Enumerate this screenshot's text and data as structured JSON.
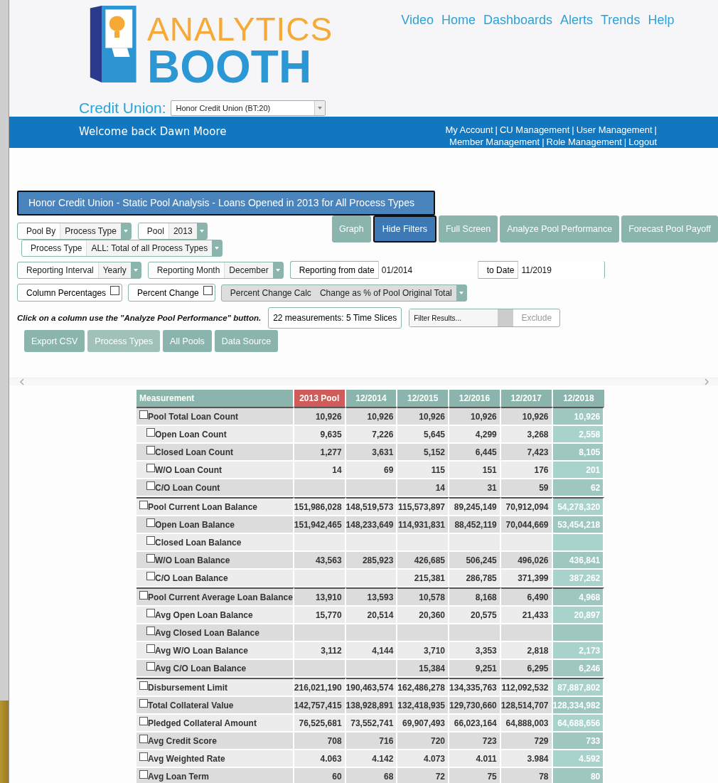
{
  "header": {
    "logo": {
      "line_1": "ANALYTICS",
      "line_2": "BOOTH"
    },
    "nav": [
      "Video",
      "Home",
      "Dashboards",
      "Alerts",
      "Trends",
      "Help"
    ],
    "credit_union": {
      "label": "Credit Union:",
      "value": "Honor Credit Union (BT:20)"
    }
  },
  "welcome_bar": {
    "greeting": "Welcome back Dawn Moore",
    "links_line_1": [
      "My Account",
      "CU Management",
      "User Management"
    ],
    "links_line_2": [
      "Member Management",
      "Role Management",
      "Logout"
    ],
    "separator": "|"
  },
  "report_title": "Honor Credit Union - Static Pool Analysis - Loans Opened in 2013 for All Process Types",
  "filters": {
    "row_1": [
      {
        "label": "Pool By",
        "value": "Process Type"
      },
      {
        "label": "Pool",
        "value": "2013"
      }
    ],
    "row_2": [
      {
        "label": "Process Type",
        "value": "ALL: Total of all Process Types"
      }
    ],
    "row_3": [
      {
        "label": "Reporting Interval",
        "value": "Yearly"
      },
      {
        "label": "Reporting Month",
        "value": "December"
      }
    ],
    "date_range": {
      "from_label": "Reporting from date",
      "from": "01/2014",
      "to_label": "to Date",
      "to": "11/2019"
    },
    "checkboxes": [
      {
        "label": "Column Percentages",
        "checked": false
      },
      {
        "label": "Percent Change",
        "checked": false
      }
    ],
    "percent_change_calc": {
      "label": "Percent Change Calc",
      "value": "Change as % of Pool Original Total"
    },
    "hint": "Click on a column use the \"Analyze Pool Performance\" button.",
    "measurements": "22 measurements: 5 Time Slices",
    "filter_results": {
      "placeholder": "Filter Results...",
      "toggle_label": "Exclude",
      "on": false
    }
  },
  "view_buttons": [
    {
      "label": "Graph",
      "selected": false
    },
    {
      "label": "Hide Filters",
      "selected": true
    },
    {
      "label": "Full Screen",
      "selected": false
    },
    {
      "label": "Analyze Pool Performance",
      "selected": false
    },
    {
      "label": "Forecast Pool Payoff",
      "selected": false
    }
  ],
  "action_buttons": [
    {
      "label": "Export CSV",
      "disabled": false
    },
    {
      "label": "Process Types",
      "disabled": true
    },
    {
      "label": "All Pools",
      "disabled": false
    },
    {
      "label": "Data Source",
      "disabled": false
    }
  ],
  "table": {
    "columns": [
      {
        "label": "Measurement",
        "kind": "measure",
        "selected": false
      },
      {
        "label": "2013 Pool",
        "kind": "pool",
        "selected": false
      },
      {
        "label": "12/2014",
        "kind": "period",
        "selected": false
      },
      {
        "label": "12/2015",
        "kind": "period",
        "selected": false
      },
      {
        "label": "12/2016",
        "kind": "period",
        "selected": false
      },
      {
        "label": "12/2017",
        "kind": "period",
        "selected": false
      },
      {
        "label": "12/2018",
        "kind": "period",
        "selected": true
      }
    ],
    "rows": [
      {
        "label": "Pool Total Loan Count",
        "checked": false,
        "values": [
          "10,926",
          "10,926",
          "10,926",
          "10,926",
          "10,926",
          "10,926"
        ],
        "children": [
          {
            "label": "Open Loan Count",
            "checked": false,
            "values": [
              "9,635",
              "7,226",
              "5,645",
              "4,299",
              "3,268",
              "2,558"
            ]
          },
          {
            "label": "Closed Loan Count",
            "checked": false,
            "values": [
              "1,277",
              "3,631",
              "5,152",
              "6,445",
              "7,423",
              "8,105"
            ]
          },
          {
            "label": "W/O Loan Count",
            "checked": false,
            "values": [
              "14",
              "69",
              "115",
              "151",
              "176",
              "201"
            ]
          },
          {
            "label": "C/O Loan Count",
            "checked": false,
            "values": [
              {
                "empty": true
              },
              {
                "empty": true
              },
              "14",
              "31",
              "59",
              "62"
            ]
          }
        ]
      },
      {
        "label": "Pool Current Loan Balance",
        "checked": false,
        "values": [
          "151,986,028",
          "148,519,573",
          "115,573,897",
          "89,245,149",
          "70,912,094",
          "54,278,320"
        ],
        "children": [
          {
            "label": "Open Loan Balance",
            "checked": false,
            "values": [
              "151,942,465",
              "148,233,649",
              "114,931,831",
              "88,452,119",
              "70,044,669",
              "53,454,218"
            ]
          },
          {
            "label": "Closed Loan Balance",
            "checked": false,
            "values": [
              {
                "empty": true
              },
              {
                "empty": true
              },
              {
                "empty": true
              },
              {
                "empty": true
              },
              {
                "empty": true
              },
              {
                "empty": true
              }
            ]
          },
          {
            "label": "W/O Loan Balance",
            "checked": false,
            "values": [
              "43,563",
              "285,923",
              "426,685",
              "506,245",
              "496,026",
              "436,841"
            ]
          },
          {
            "label": "C/O Loan Balance",
            "checked": false,
            "values": [
              {
                "empty": true
              },
              {
                "empty": true
              },
              "215,381",
              "286,785",
              "371,399",
              "387,262"
            ]
          }
        ]
      },
      {
        "label": "Pool Current Average Loan Balance",
        "checked": false,
        "values": [
          "13,910",
          "13,593",
          "10,578",
          "8,168",
          "6,490",
          "4,968"
        ],
        "children": [
          {
            "label": "Avg Open Loan Balance",
            "checked": false,
            "values": [
              "15,770",
              "20,514",
              "20,360",
              "20,575",
              "21,433",
              "20,897"
            ]
          },
          {
            "label": "Avg Closed Loan Balance",
            "checked": false,
            "values": [
              {
                "empty": true
              },
              {
                "empty": true
              },
              {
                "empty": true
              },
              {
                "empty": true
              },
              {
                "empty": true
              },
              {
                "empty": true
              }
            ]
          },
          {
            "label": "Avg W/O Loan Balance",
            "checked": false,
            "values": [
              "3,112",
              "4,144",
              "3,710",
              "3,353",
              "2,818",
              "2,173"
            ]
          },
          {
            "label": "Avg C/O Loan Balance",
            "checked": false,
            "values": [
              {
                "empty": true
              },
              {
                "empty": true
              },
              "15,384",
              "9,251",
              "6,295",
              "6,246"
            ]
          }
        ]
      },
      {
        "label": "Disbursement Limit",
        "checked": false,
        "values": [
          "216,021,190",
          "190,463,574",
          "162,486,278",
          "134,335,763",
          "112,092,532",
          "87,887,802"
        ]
      },
      {
        "label": "Total Collateral Value",
        "checked": false,
        "values": [
          "142,757,415",
          "138,928,891",
          "132,418,935",
          "129,730,660",
          "128,514,707",
          "128,334,982"
        ]
      },
      {
        "label": "Pledged Collateral Amount",
        "checked": false,
        "values": [
          "76,525,681",
          "73,552,741",
          "69,907,493",
          "66,023,164",
          "64,888,003",
          "64,688,656"
        ]
      },
      {
        "label": "Avg Credit Score",
        "checked": false,
        "values": [
          "708",
          "716",
          "720",
          "723",
          "729",
          "733"
        ]
      },
      {
        "label": "Avg Weighted Rate",
        "checked": false,
        "values": [
          "4.063",
          "4.142",
          "4.073",
          "4.011",
          "3.984",
          "4.592"
        ]
      },
      {
        "label": "Avg Loan Term",
        "checked": false,
        "values": [
          "60",
          "68",
          "72",
          "75",
          "78",
          "80"
        ]
      }
    ]
  }
}
